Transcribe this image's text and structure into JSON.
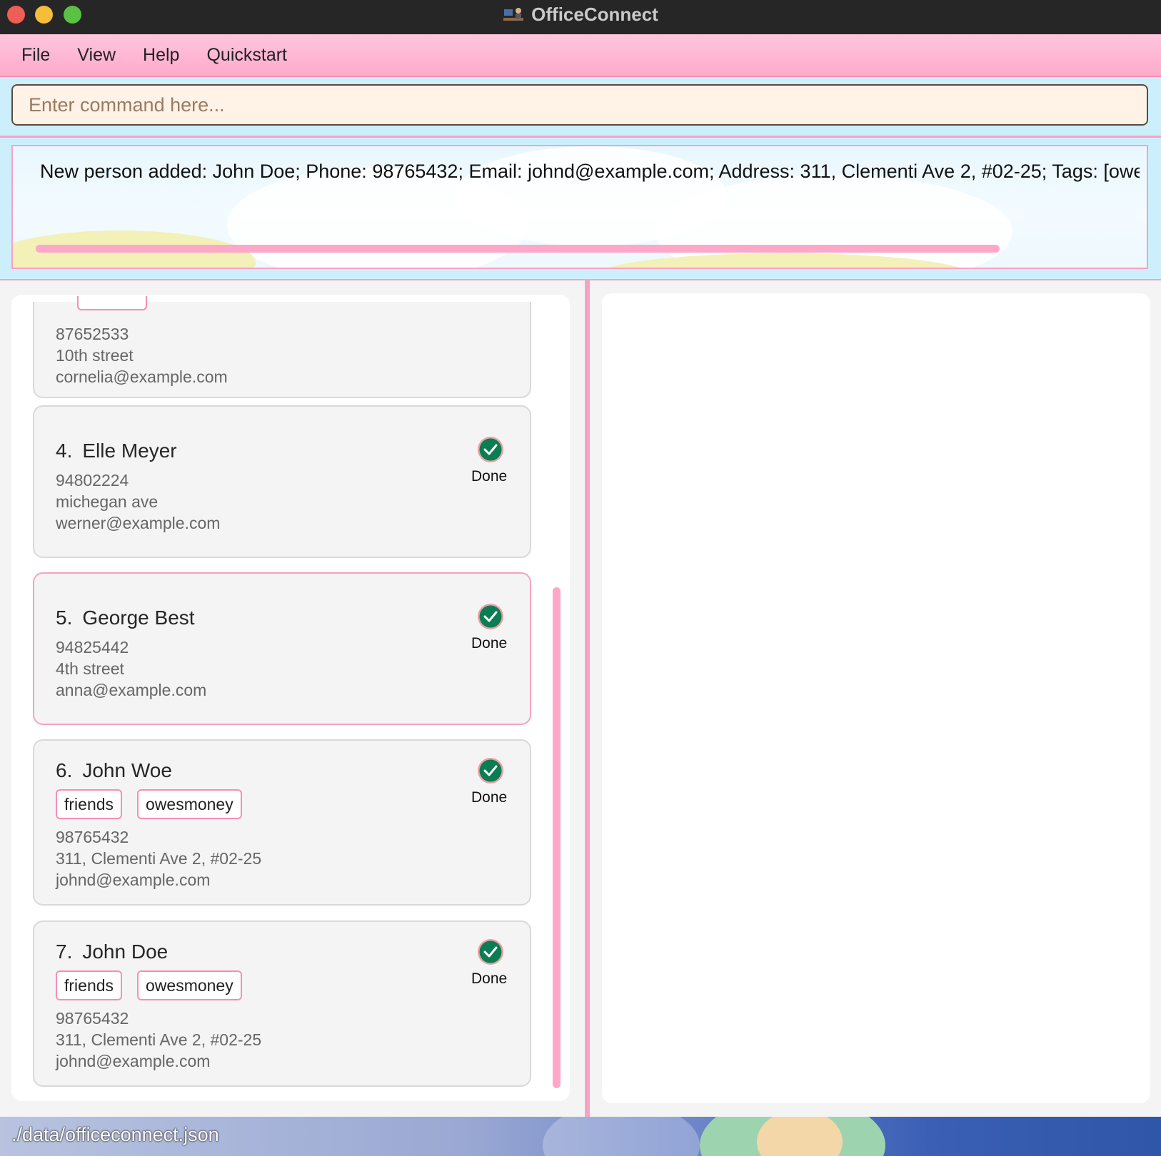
{
  "window": {
    "title": "OfficeConnect"
  },
  "menu": [
    {
      "label": "File"
    },
    {
      "label": "View"
    },
    {
      "label": "Help"
    },
    {
      "label": "Quickstart"
    }
  ],
  "command": {
    "placeholder": "Enter command here...",
    "value": ""
  },
  "result": {
    "text": "New person added: John Doe; Phone: 98765432; Email: johnd@example.com; Address: 311, Clementi Ave 2, #02-25; Tags: [owesmoney][friends]"
  },
  "persons": [
    {
      "phone": "87652533",
      "address": "10th street",
      "email": "cornelia@example.com"
    },
    {
      "index": "4.",
      "name": "Elle Meyer",
      "phone": "94802224",
      "address": "michegan ave",
      "email": "werner@example.com",
      "status": "Done"
    },
    {
      "index": "5.",
      "name": "George Best",
      "phone": "94825442",
      "address": "4th street",
      "email": "anna@example.com",
      "status": "Done"
    },
    {
      "index": "6.",
      "name": "John Woe",
      "tags": [
        "friends",
        "owesmoney"
      ],
      "phone": "98765432",
      "address": "311, Clementi Ave 2, #02-25",
      "email": "johnd@example.com",
      "status": "Done"
    },
    {
      "index": "7.",
      "name": "John Doe",
      "tags": [
        "friends",
        "owesmoney"
      ],
      "phone": "98765432",
      "address": "311, Clementi Ave 2, #02-25",
      "email": "johnd@example.com",
      "status": "Done"
    }
  ],
  "statusbar": {
    "path": "./data/officeconnect.json"
  },
  "colors": {
    "accent_pink": "#f7a2c3",
    "done_green": "#0b7d52"
  },
  "icons": {
    "done": "check-circle-icon",
    "app": "office-desk-icon"
  }
}
